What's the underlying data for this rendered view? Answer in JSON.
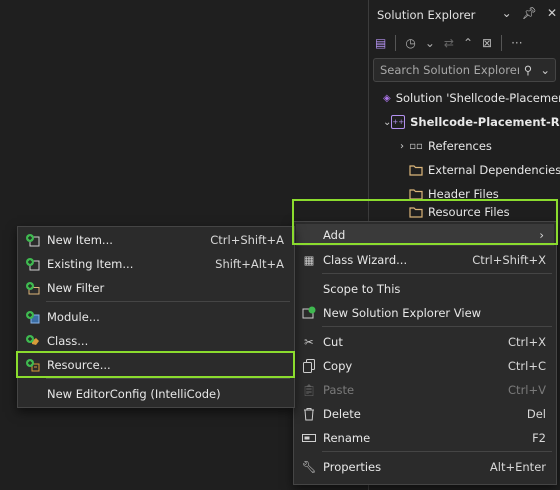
{
  "solution_explorer": {
    "title": "Solution Explorer",
    "search_placeholder": "Search Solution Explorer (C",
    "tree": [
      {
        "label": "Solution 'Shellcode-Placemen",
        "bold": false
      },
      {
        "label": "Shellcode-Placement-Res",
        "bold": true
      },
      {
        "label": "References",
        "bold": false
      },
      {
        "label": "External Dependencies",
        "bold": false
      },
      {
        "label": "Header Files",
        "bold": false
      },
      {
        "label": "Resource Files",
        "bold": false
      }
    ]
  },
  "context_menu": {
    "items": [
      {
        "label": "Add",
        "shortcut": "",
        "submenu": true
      },
      {
        "label": "Class Wizard...",
        "shortcut": "Ctrl+Shift+X"
      },
      {
        "label": "Scope to This",
        "shortcut": ""
      },
      {
        "label": "New Solution Explorer View",
        "shortcut": ""
      },
      {
        "label": "Cut",
        "shortcut": "Ctrl+X"
      },
      {
        "label": "Copy",
        "shortcut": "Ctrl+C"
      },
      {
        "label": "Paste",
        "shortcut": "Ctrl+V",
        "disabled": true
      },
      {
        "label": "Delete",
        "shortcut": "Del"
      },
      {
        "label": "Rename",
        "shortcut": "F2"
      },
      {
        "label": "Properties",
        "shortcut": "Alt+Enter"
      }
    ]
  },
  "add_submenu": {
    "items": [
      {
        "label": "New Item...",
        "shortcut": "Ctrl+Shift+A"
      },
      {
        "label": "Existing Item...",
        "shortcut": "Shift+Alt+A"
      },
      {
        "label": "New Filter",
        "shortcut": ""
      },
      {
        "label": "Module...",
        "shortcut": ""
      },
      {
        "label": "Class...",
        "shortcut": ""
      },
      {
        "label": "Resource...",
        "shortcut": ""
      },
      {
        "label": "New EditorConfig (IntelliCode)",
        "shortcut": ""
      }
    ]
  },
  "colors": {
    "highlight": "#8bdc2e",
    "menu_bg": "#2b2b2b",
    "folder": "#dcb67a",
    "add_green": "#3fb950",
    "project_purple": "#a974e6"
  }
}
